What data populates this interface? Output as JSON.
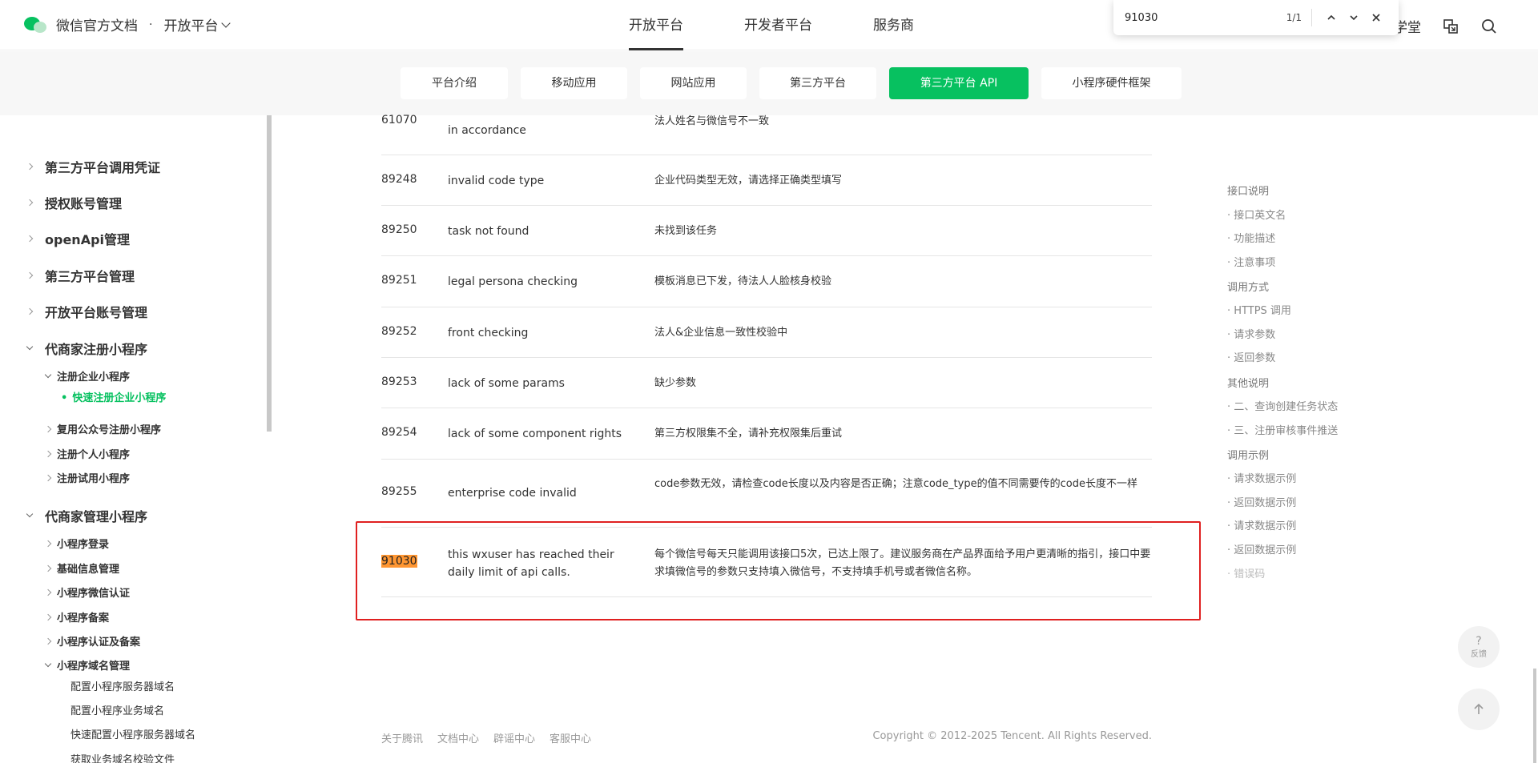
{
  "header": {
    "brand_title": "微信官方文档",
    "brand_sub": "开放平台",
    "nav": [
      "开放平台",
      "开发者平台",
      "服务商"
    ],
    "active_nav": 0,
    "right_partial": "学堂"
  },
  "findbar": {
    "query": "91030",
    "count": "1/1",
    "prev": "∧",
    "next": "∨",
    "close": "✕"
  },
  "subnav": {
    "tabs": [
      "平台介绍",
      "移动应用",
      "网站应用",
      "第三方平台",
      "第三方平台 API",
      "小程序硬件框架"
    ],
    "active_tab": 4
  },
  "sidebar": {
    "l1": [
      "第三方平台调用凭证",
      "授权账号管理",
      "openApi管理",
      "第三方平台管理",
      "开放平台账号管理",
      "代商家注册小程序",
      "代商家管理小程序"
    ],
    "reg_l2": [
      "注册企业小程序",
      "复用公众号注册小程序",
      "注册个人小程序",
      "注册试用小程序"
    ],
    "active_item": "快速注册企业小程序",
    "mgmt_l2": [
      "小程序登录",
      "基础信息管理",
      "小程序微信认证",
      "小程序备案",
      "小程序认证及备案",
      "小程序域名管理"
    ],
    "domain_l3": [
      "配置小程序服务器域名",
      "配置小程序业务域名",
      "快速配置小程序服务器域名",
      "获取业务域名校验文件"
    ]
  },
  "table": {
    "rows": [
      {
        "code": "61070",
        "en": "in accordance",
        "zh": "法人姓名与微信号不一致"
      },
      {
        "code": "89248",
        "en": "invalid code type",
        "zh": "企业代码类型无效，请选择正确类型填写"
      },
      {
        "code": "89250",
        "en": "task not found",
        "zh": "未找到该任务"
      },
      {
        "code": "89251",
        "en": "legal persona checking",
        "zh": "模板消息已下发，待法人人脸核身校验"
      },
      {
        "code": "89252",
        "en": "front checking",
        "zh": "法人&企业信息一致性校验中"
      },
      {
        "code": "89253",
        "en": "lack of some params",
        "zh": "缺少参数"
      },
      {
        "code": "89254",
        "en": "lack of some component rights",
        "zh": "第三方权限集不全，请补充权限集后重试"
      },
      {
        "code": "89255",
        "en": "enterprise code invalid",
        "zh": "code参数无效，请检查code长度以及内容是否正确；注意code_type的值不同需要传的code长度不一样"
      },
      {
        "code": "91030",
        "en": "this wxuser has reached their daily limit of api calls.",
        "zh": "每个微信号每天只能调用该接口5次，已达上限了。建议服务商在产品界面给予用户更清晰的指引，接口中要求填微信号的参数只支持填入微信号，不支持填手机号或者微信名称。"
      }
    ]
  },
  "footer": {
    "links": [
      "关于腾讯",
      "文档中心",
      "辟谣中心",
      "客服中心"
    ],
    "copyright": "Copyright © 2012-2025 Tencent. All Rights Reserved."
  },
  "toc": {
    "items": [
      {
        "text": "接口说明",
        "kind": "h"
      },
      {
        "text": "· 接口英文名",
        "kind": "s"
      },
      {
        "text": "· 功能描述",
        "kind": "s"
      },
      {
        "text": "· 注意事项",
        "kind": "s"
      },
      {
        "text": "调用方式",
        "kind": "h"
      },
      {
        "text": "· HTTPS 调用",
        "kind": "s"
      },
      {
        "text": "· 请求参数",
        "kind": "s"
      },
      {
        "text": "· 返回参数",
        "kind": "s"
      },
      {
        "text": "其他说明",
        "kind": "h"
      },
      {
        "text": "· 二、查询创建任务状态",
        "kind": "s"
      },
      {
        "text": "· 三、注册审核事件推送",
        "kind": "s"
      },
      {
        "text": "调用示例",
        "kind": "h"
      },
      {
        "text": "· 请求数据示例",
        "kind": "s"
      },
      {
        "text": "· 返回数据示例",
        "kind": "s"
      },
      {
        "text": "· 请求数据示例",
        "kind": "s"
      },
      {
        "text": "· 返回数据示例",
        "kind": "s"
      },
      {
        "text": "· 错误码",
        "kind": "dim"
      }
    ]
  },
  "float": {
    "feedback_q": "?",
    "feedback_label": "反馈",
    "top_arrow": "↑"
  },
  "colors": {
    "accent": "#07c160",
    "highlight": "#ff9632",
    "annotation": "#e02020"
  }
}
